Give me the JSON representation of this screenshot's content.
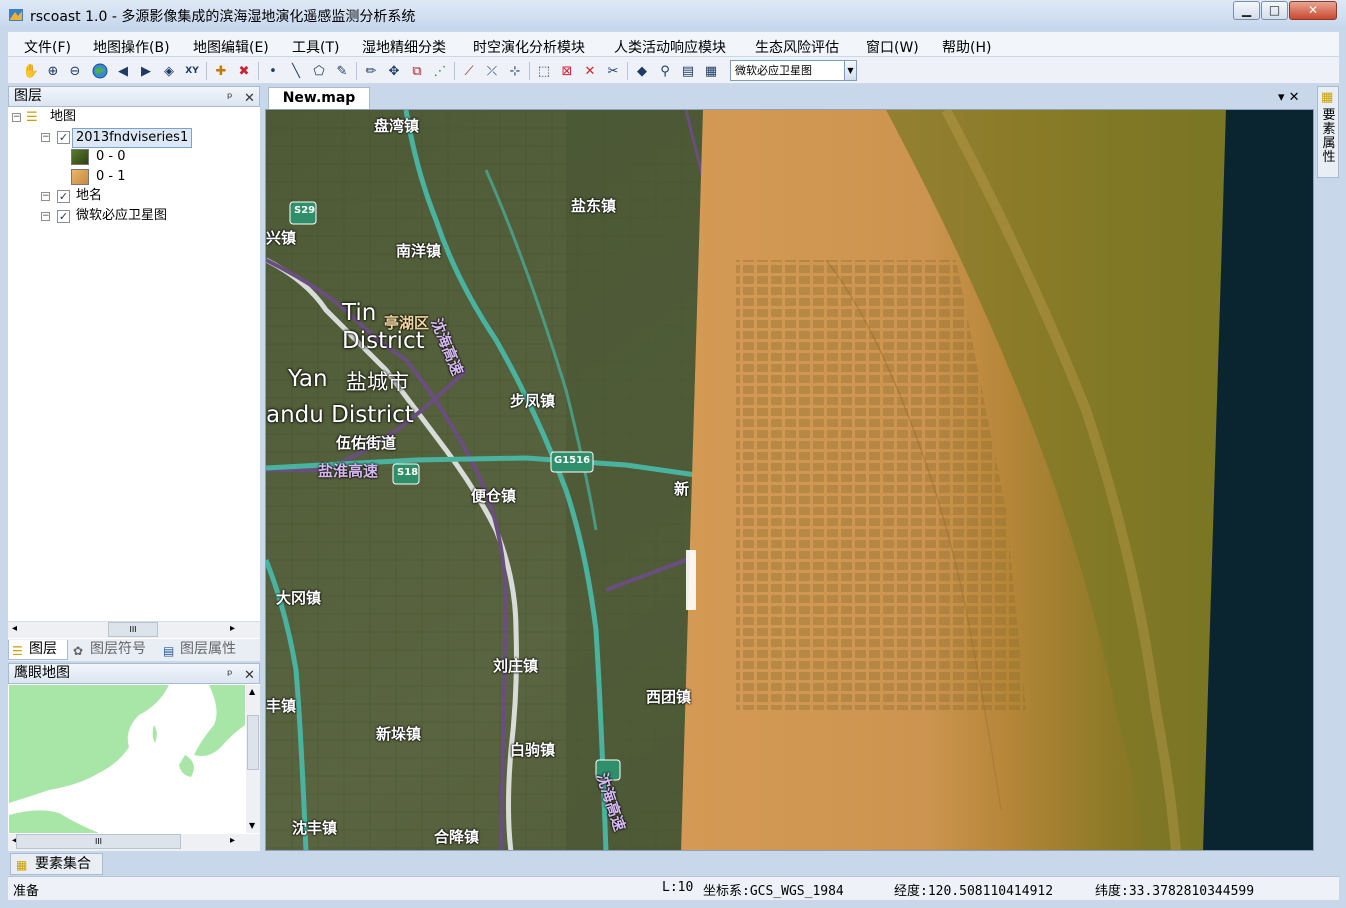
{
  "window": {
    "title": "rscoast 1.0 - 多源影像集成的滨海湿地演化遥感监测分析系统",
    "min": "▁",
    "max": "□",
    "close": "✕"
  },
  "menu": [
    "文件(F)",
    "地图操作(B)",
    "地图编辑(E)",
    "工具(T)",
    "湿地精细分类",
    "时空演化分析模块",
    "人类活动响应模块",
    "生态风险评估",
    "窗口(W)",
    "帮助(H)"
  ],
  "toolbar": {
    "icons": [
      "pan-icon",
      "zoom-in-icon",
      "zoom-out-icon",
      "globe-icon",
      "back-arrow-icon",
      "forward-arrow-icon",
      "select-identify-icon",
      "xy-goto-icon",
      "add-data-icon",
      "remove-layer-icon",
      "point-icon",
      "line-icon",
      "polygon-icon",
      "edit-sketch-icon",
      "pencil-icon",
      "move-icon",
      "split-icon",
      "vertex-icon",
      "draw-line-icon",
      "trim-icon",
      "snap-icon",
      "select-box-icon",
      "delete-select-icon",
      "delete-icon",
      "cut-icon",
      "locate-icon",
      "find-icon",
      "measure-icon",
      "attribute-table-icon"
    ],
    "scale_value": "微软必应卫星图"
  },
  "toc": {
    "title": "图层",
    "pin": "ᵖ",
    "close": "✕",
    "root": "地图",
    "layers": [
      {
        "name": "2013fndviseries1",
        "checked": true,
        "legend": [
          {
            "label": "0 - 0",
            "color": "#3f5a1e"
          },
          {
            "label": "0 - 1",
            "color": "#d8a35a"
          }
        ]
      },
      {
        "name": "地名",
        "checked": true
      },
      {
        "name": "微软必应卫星图",
        "checked": true
      }
    ],
    "scroll_glyph": "III",
    "tabs": [
      "图层",
      "图层符号",
      "图层属性"
    ]
  },
  "overview": {
    "title": "鹰眼地图",
    "pin": "ᵖ",
    "close": "✕",
    "scroll_glyph": "III"
  },
  "document": {
    "tab": "New.map",
    "controls": "▾ ✕"
  },
  "map": {
    "places": [
      "盘湾镇",
      "盐东镇",
      "兴镇",
      "南洋镇",
      "亭湖区",
      "盐城市",
      "步凤镇",
      "伍佑街道",
      "便仓镇",
      "大冈镇",
      "刘庄镇",
      "西团镇",
      "丰镇",
      "新垛镇",
      "白驹镇",
      "沈丰镇",
      "合降镇",
      "新"
    ],
    "english": [
      "Tin",
      "District",
      "Yan",
      "andu District"
    ],
    "roads": [
      "盐淮高速",
      "沈海高速",
      "沈海高速"
    ],
    "shields": [
      "S29",
      "S18",
      "G1516"
    ],
    "colors": {
      "ndvi_low": "#6b7a2a",
      "ndvi_high": "#d29a55",
      "sea": "#0b2530"
    }
  },
  "right_dock": {
    "label": "要素属性"
  },
  "bottom_tab": {
    "label": "要素集合"
  },
  "status": {
    "left": "准备",
    "level": "L:10",
    "crs": "坐标系:GCS_WGS_1984",
    "lon": "经度:120.508110414912",
    "lat": "纬度:33.3782810344599"
  }
}
